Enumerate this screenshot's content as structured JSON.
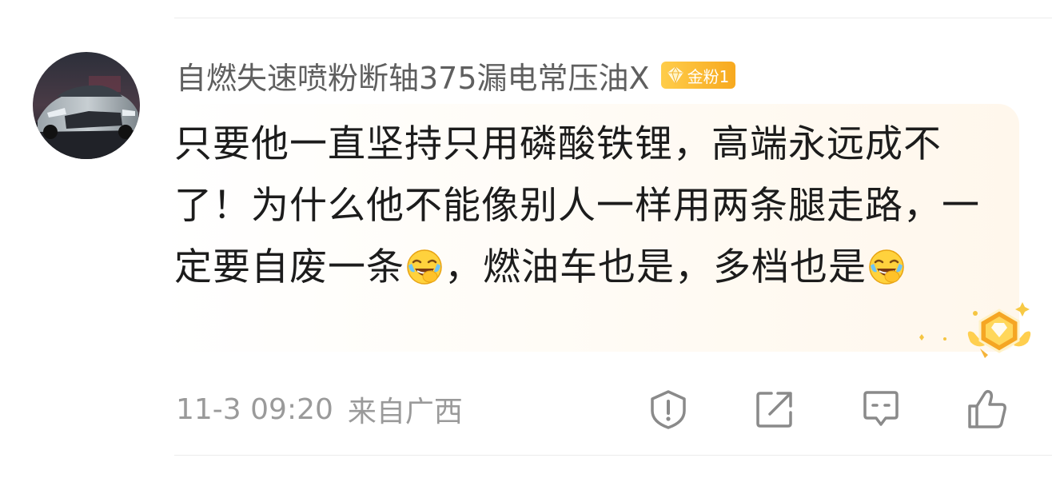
{
  "comment": {
    "username": "自燃失速喷粉断轴375漏电常压油X",
    "badge": {
      "label": "金粉1",
      "icon": "diamond-icon",
      "color": "#f7a91f"
    },
    "avatar": {
      "icon": "car-avatar"
    },
    "text_segments": [
      "只要他一直坚持只用磷酸铁锂，高端永远成不了！为什么他不能像别人一样用两条腿走路，一定要自废一条",
      "，燃油车也是，多档也是"
    ],
    "emoji_name": "laugh-cry-emoji",
    "timestamp": "11-3 09:20",
    "location": "来自广西"
  },
  "actions": {
    "report_icon": "report-icon",
    "share_icon": "share-icon",
    "comment_icon": "comment-icon",
    "like_icon": "like-icon"
  },
  "colors": {
    "username": "#5f5f5f",
    "text": "#1c1c1c",
    "meta": "#9a9a9a",
    "badge": "#f7a91f"
  }
}
